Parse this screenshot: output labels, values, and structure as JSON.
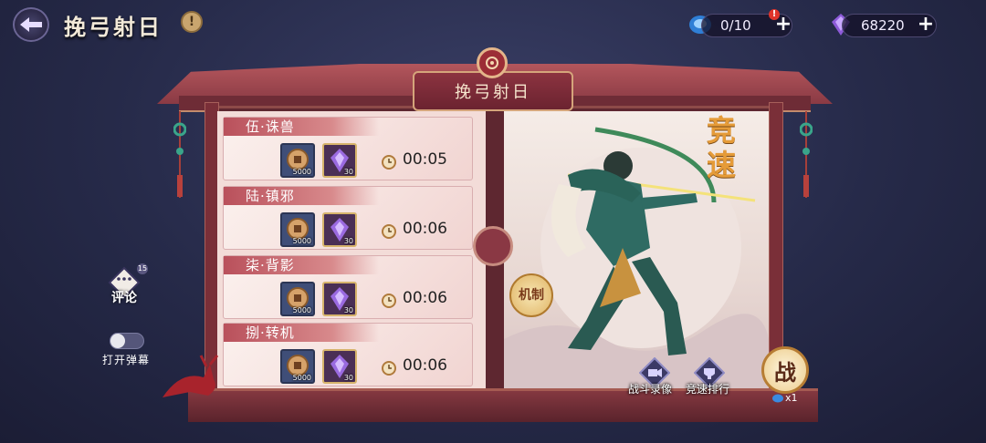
{
  "header": {
    "title": "挽弓射日",
    "info_icon": "info-icon",
    "back_icon": "back-arrow-icon"
  },
  "resources": {
    "stamina": {
      "value": "0/10",
      "icon": "stamina-orb-icon"
    },
    "gems": {
      "value": "68220",
      "icon": "purple-gem-icon"
    }
  },
  "panel": {
    "title": "挽弓射日"
  },
  "levels": [
    {
      "name": "伍·诛兽",
      "coin_qty": "5000",
      "gem_qty": "30",
      "time": "00:05"
    },
    {
      "name": "陆·镇邪",
      "coin_qty": "5000",
      "gem_qty": "30",
      "time": "00:06"
    },
    {
      "name": "柒·背影",
      "coin_qty": "5000",
      "gem_qty": "30",
      "time": "00:06"
    },
    {
      "name": "捌·转机",
      "coin_qty": "5000",
      "gem_qty": "30",
      "time": "00:06"
    }
  ],
  "hero": {
    "tag_speed": "竞速",
    "tag_mechanism": "机制"
  },
  "actions": {
    "record_label": "战斗录像",
    "rank_label": "竞速排行",
    "battle_label": "战",
    "battle_cost": "x1"
  },
  "side": {
    "comment_label": "评论",
    "comment_count": "15",
    "danmaku_label": "打开弹幕"
  },
  "colors": {
    "frame_red": "#8a3a44",
    "level_header": "#b9505b",
    "gold_accent": "#d6b36b",
    "speed_tag": "#e59b38"
  }
}
